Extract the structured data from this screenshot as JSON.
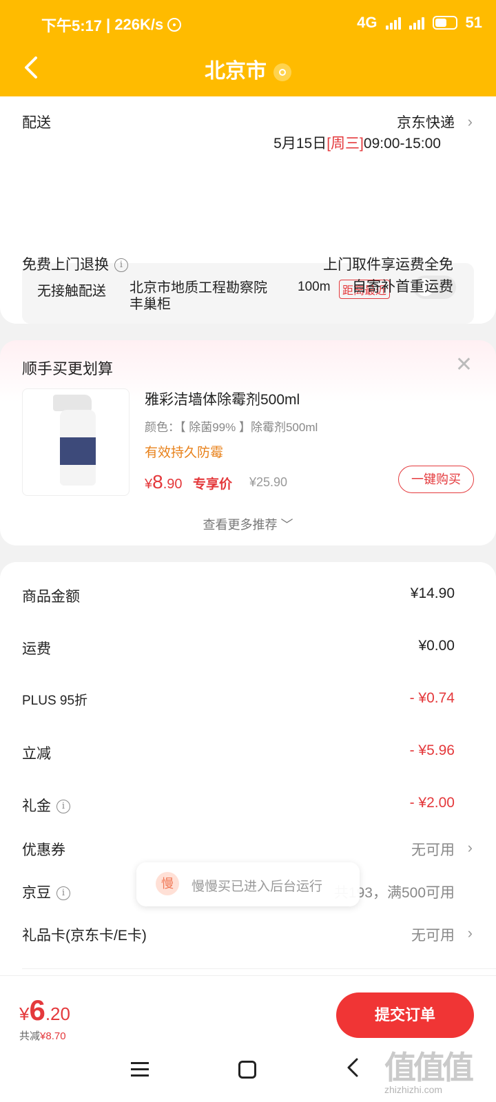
{
  "status_bar": {
    "time": "下午5:17",
    "speed": "| 226K/s",
    "network": "4G",
    "battery": "51"
  },
  "nav": {
    "title": "北京市",
    "back_icon": "chevron-left-icon",
    "location_icon": "location-pin-icon"
  },
  "delivery": {
    "label": "配送",
    "carrier": "京东快递",
    "date": "5月15日",
    "weekday": "[周三]",
    "time_window": "09:00-15:00"
  },
  "no_contact": {
    "label": "无接触配送",
    "place_line1": "北京市地质工程勘察院",
    "place_line2": "丰巢柜",
    "distance": "100m",
    "tag": "距离最近",
    "toggle_on": false
  },
  "returns": {
    "label": "免费上门退换",
    "line1": "上门取件享运费全免",
    "line2": "自寄补首重运费"
  },
  "recommend": {
    "title": "顺手买更划算",
    "product_name": "雅彩洁墙体除霉剂500ml",
    "spec": "颜色：【 除菌99% 】除霉剂500ml",
    "feature": "有效持久防霉",
    "price_yen": "¥",
    "price_int": "8",
    "price_dec": ".90",
    "price_label": "专享价",
    "orig_price": "¥25.90",
    "buy_label": "一键购买",
    "more_label": "查看更多推荐 ﹀"
  },
  "fees": [
    {
      "label": "商品金额",
      "value": "¥14.90",
      "red": false
    },
    {
      "label": "运费",
      "value": "¥0.00",
      "red": false
    },
    {
      "label": "PLUS 95折",
      "value": "- ¥0.74",
      "red": true
    },
    {
      "label": "立减",
      "value": "- ¥5.96",
      "red": true
    },
    {
      "label": "礼金",
      "value": "- ¥2.00",
      "red": true
    }
  ],
  "coupon": {
    "label": "优惠券",
    "value": "无可用"
  },
  "jingdou": {
    "label": "京豆",
    "value": "共193，满500可用"
  },
  "giftcard": {
    "label": "礼品卡(京东卡/E卡)",
    "value": "无可用"
  },
  "toast": {
    "icon_char": "慢",
    "text": "慢慢买已进入后台运行"
  },
  "bottom": {
    "yen": "¥",
    "total_int": "6",
    "total_dec": ".20",
    "saved_label": "共减",
    "saved_value": "¥8.70",
    "submit_label": "提交订单"
  },
  "watermark": {
    "logo": "值值值",
    "url": "zhizhizhi.com"
  },
  "colors": {
    "header": "#ffbb00",
    "accent_red": "#e4393c",
    "orange": "#e8811a"
  }
}
